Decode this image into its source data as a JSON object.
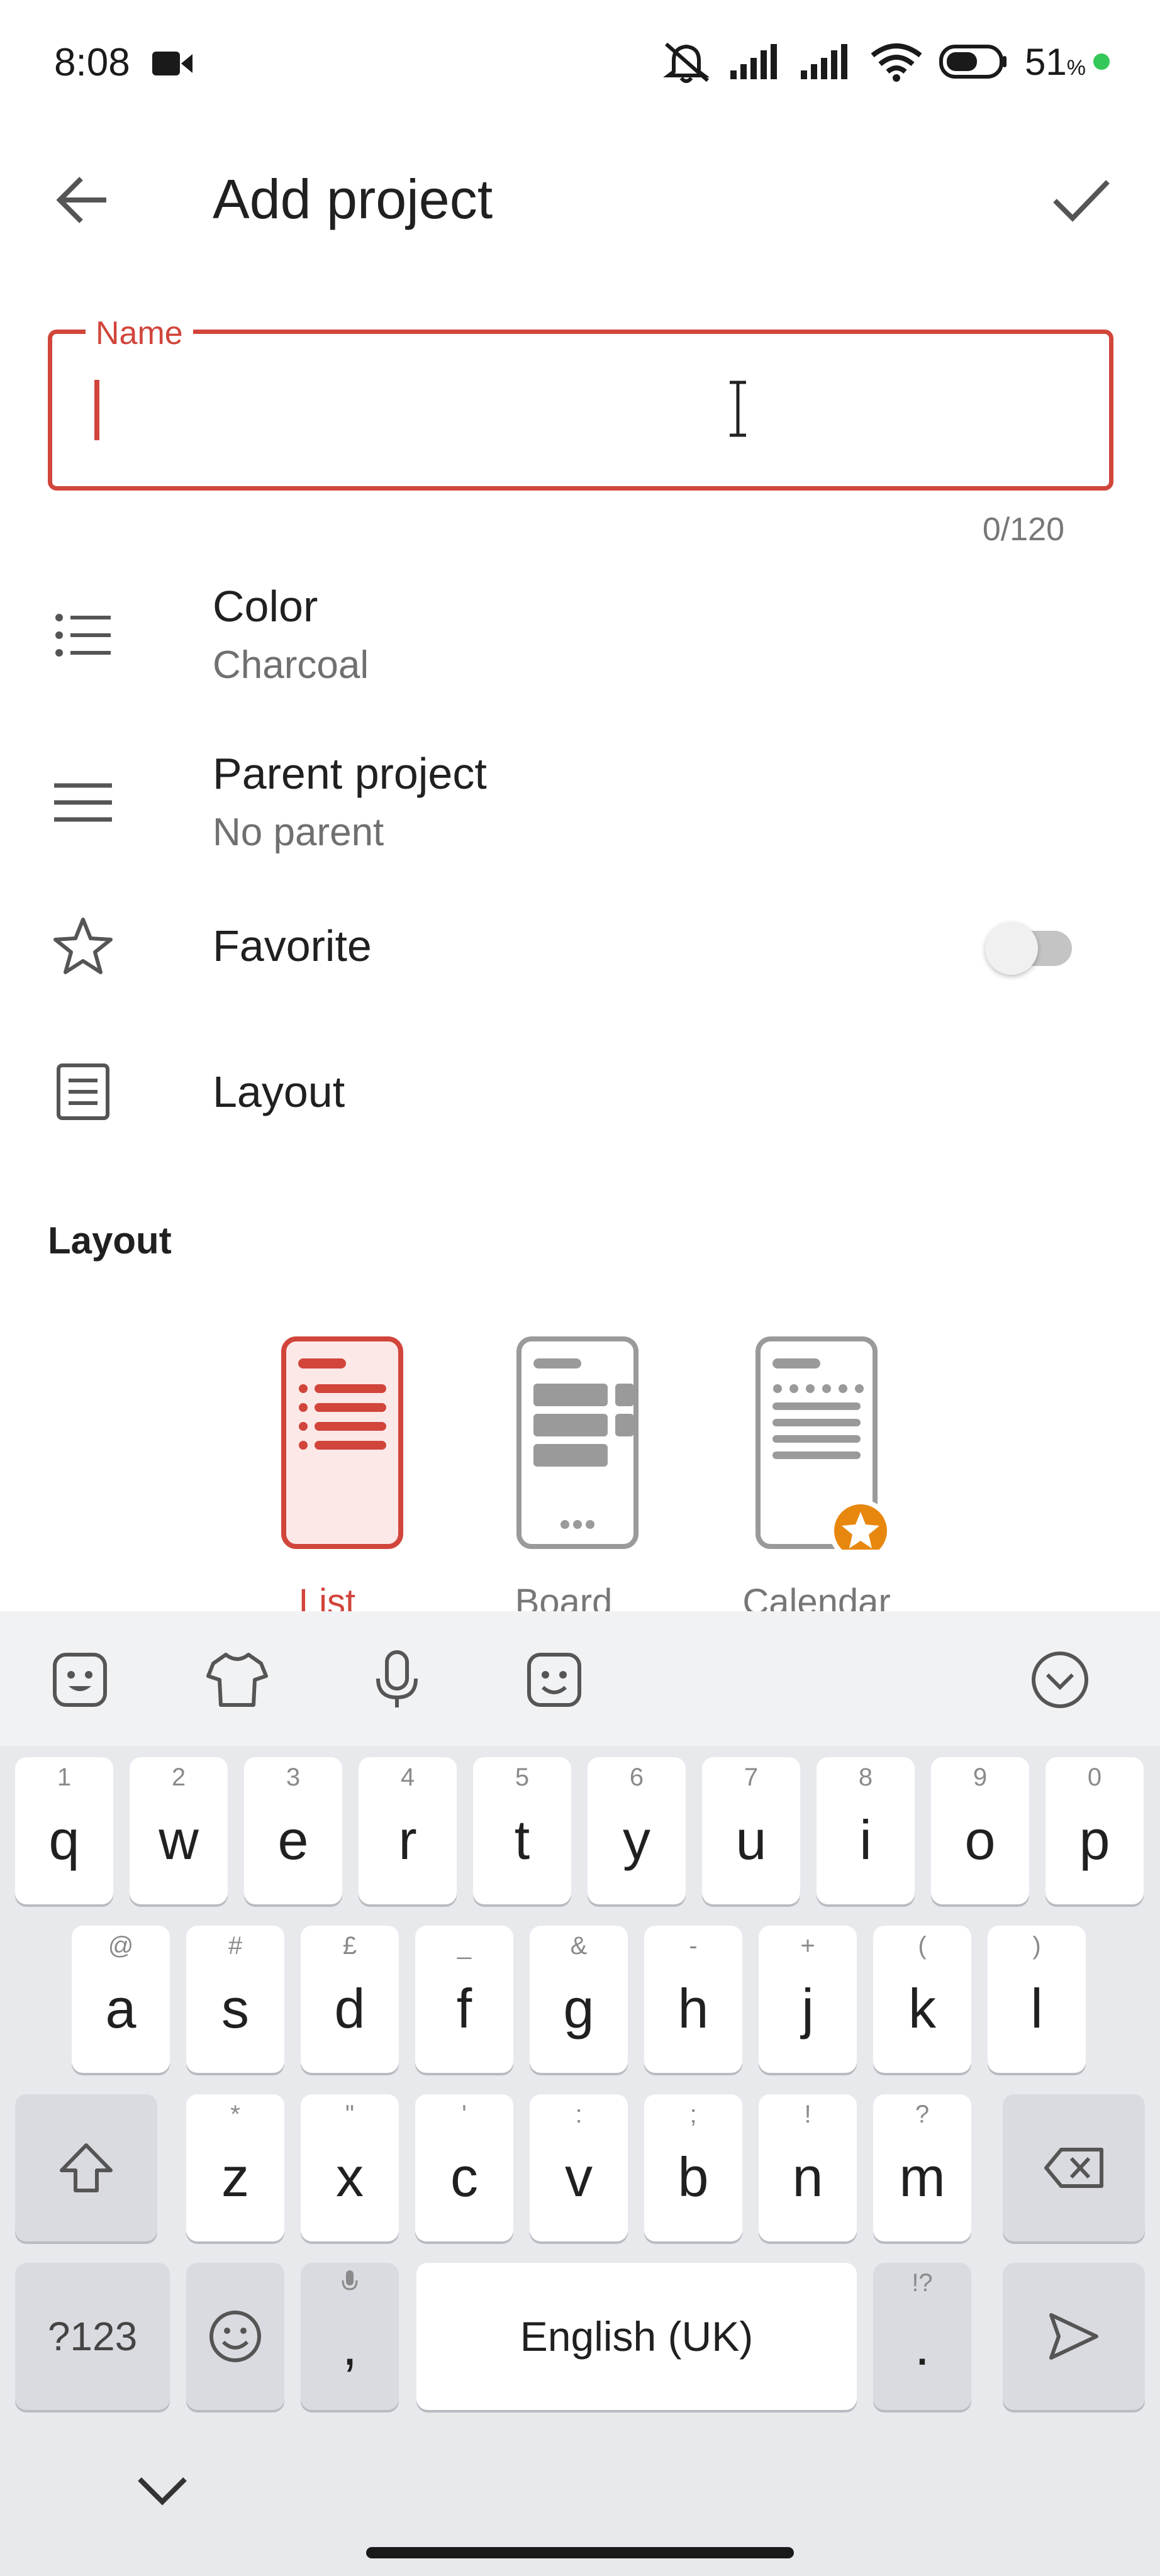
{
  "status_bar": {
    "time": "8:08",
    "battery": "51",
    "battery_unit": "%"
  },
  "app_bar": {
    "title": "Add project"
  },
  "name_field": {
    "label": "Name",
    "value": "",
    "counter": "0/120"
  },
  "rows": {
    "color": {
      "title": "Color",
      "subtitle": "Charcoal"
    },
    "parent": {
      "title": "Parent project",
      "subtitle": "No parent"
    },
    "favorite": {
      "title": "Favorite",
      "enabled": false
    },
    "layout": {
      "title": "Layout"
    }
  },
  "layout_section": {
    "header": "Layout",
    "options": [
      {
        "label": "List",
        "selected": true
      },
      {
        "label": "Board",
        "selected": false
      },
      {
        "label": "Calendar",
        "selected": false,
        "premium": true
      }
    ]
  },
  "keyboard": {
    "row1": [
      {
        "key": "q",
        "hint": "1"
      },
      {
        "key": "w",
        "hint": "2"
      },
      {
        "key": "e",
        "hint": "3"
      },
      {
        "key": "r",
        "hint": "4"
      },
      {
        "key": "t",
        "hint": "5"
      },
      {
        "key": "y",
        "hint": "6"
      },
      {
        "key": "u",
        "hint": "7"
      },
      {
        "key": "i",
        "hint": "8"
      },
      {
        "key": "o",
        "hint": "9"
      },
      {
        "key": "p",
        "hint": "0"
      }
    ],
    "row2": [
      {
        "key": "a",
        "hint": "@"
      },
      {
        "key": "s",
        "hint": "#"
      },
      {
        "key": "d",
        "hint": "£"
      },
      {
        "key": "f",
        "hint": "_"
      },
      {
        "key": "g",
        "hint": "&"
      },
      {
        "key": "h",
        "hint": "-"
      },
      {
        "key": "j",
        "hint": "+"
      },
      {
        "key": "k",
        "hint": "("
      },
      {
        "key": "l",
        "hint": ")"
      }
    ],
    "row3": [
      {
        "key": "z",
        "hint": "*"
      },
      {
        "key": "x",
        "hint": "\""
      },
      {
        "key": "c",
        "hint": "'"
      },
      {
        "key": "v",
        "hint": ":"
      },
      {
        "key": "b",
        "hint": ";"
      },
      {
        "key": "n",
        "hint": "!"
      },
      {
        "key": "m",
        "hint": "?"
      }
    ],
    "symbols_key": "?123",
    "comma_key": ",",
    "space_label": "English (UK)",
    "period_key": ".",
    "period_hint": "!?"
  },
  "colors": {
    "accent": "#d1453b",
    "premium": "#e8870e",
    "text": "#202020",
    "secondary": "#707070"
  }
}
